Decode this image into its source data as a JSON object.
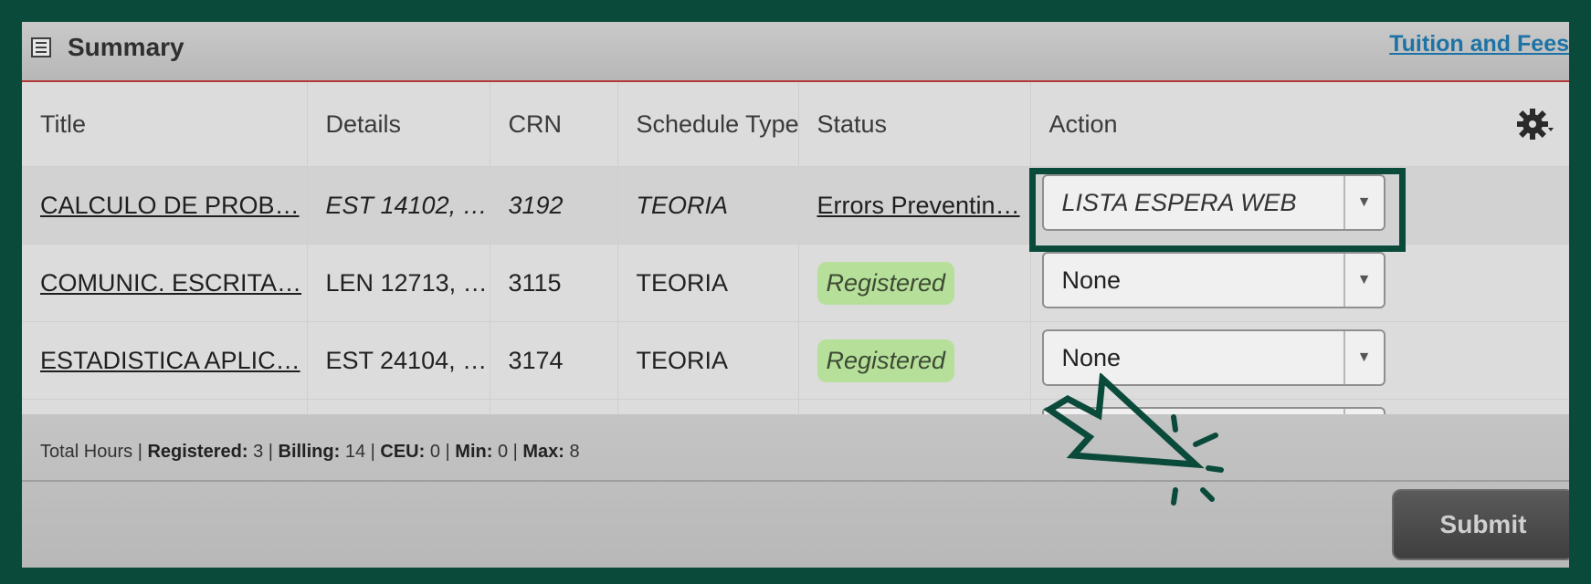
{
  "header": {
    "title": "Summary",
    "tuition_link": "Tuition and Fees",
    "icons": [
      "table-icon"
    ]
  },
  "table": {
    "columns": [
      "Title",
      "Details",
      "CRN",
      "Schedule Type",
      "Status",
      "Action"
    ],
    "rows": [
      {
        "title": "CALCULO DE PROB…",
        "details": "EST 14102, …",
        "crn": "3192",
        "schedule_type": "TEORIA",
        "status": "Errors Preventin…",
        "action": "LISTA ESPERA WEB"
      },
      {
        "title": "COMUNIC. ESCRITA…",
        "details": "LEN 12713, …",
        "crn": "3115",
        "schedule_type": "TEORIA",
        "status": "Registered",
        "action": "None"
      },
      {
        "title": "ESTADISTICA APLIC…",
        "details": "EST 24104, …",
        "crn": "3174",
        "schedule_type": "TEORIA",
        "status": "Registered",
        "action": "None"
      }
    ]
  },
  "footer": {
    "total_hours": "Total Hours",
    "registered_label": "Registered:",
    "registered": "3",
    "billing_label": "Billing:",
    "billing": "14",
    "ceu_label": "CEU:",
    "ceu": "0",
    "min_label": "Min:",
    "min": "0",
    "max_label": "Max:",
    "max": "8",
    "submit_label": "Submit"
  },
  "colors": {
    "background": "#0a4a3a",
    "registered_badge": "#b6e09a",
    "link": "#1d73a5"
  }
}
